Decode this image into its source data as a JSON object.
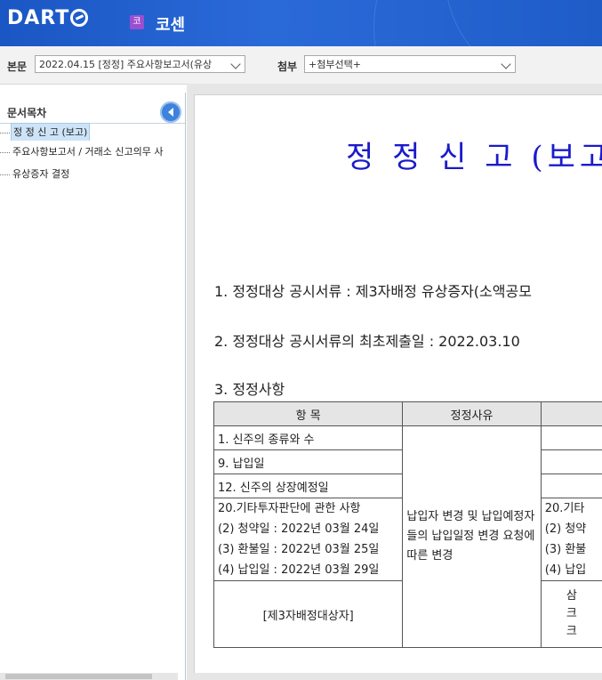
{
  "header": {
    "logo_text": "DART",
    "company_icon": "코",
    "company_name": "코센"
  },
  "toolbar": {
    "report_label": "본문",
    "report_select": "2022.04.15 [정정] 주요사항보고서(유상",
    "attach_label": "첨부",
    "attach_select": "+첨부선택+"
  },
  "sidebar": {
    "title": "문서목차",
    "items": [
      {
        "label": "정 정 신 고 (보고)",
        "selected": true
      },
      {
        "label": "주요사항보고서 / 거래소 신고의무 사"
      },
      {
        "label": "유상증자 결정"
      }
    ]
  },
  "document": {
    "title": "정 정 신 고 (보고",
    "line1": "1. 정정대상 공시서류 : 제3자배정 유상증자(소액공모",
    "line2": "2. 정정대상 공시서류의 최초제출일 : 2022.03.10",
    "line3": "3. 정정사항",
    "table": {
      "headers": [
        "항  목",
        "정정사유",
        ""
      ],
      "rows": {
        "r1": "1. 신주의 종류와 수",
        "r2": "9. 납입일",
        "r3": "12. 신주의 상장예정일",
        "r4": [
          "20.기타투자판단에 관한 사항",
          "(2) 청약일 : 2022년 03월 24일",
          "(3) 환불일 : 2022년 03월 25일",
          "(4) 납입일 : 2022년 03월 29일"
        ],
        "r5": "[제3자배정대상자]",
        "reason": "납입자 변경 및 납입예정자들의 납입일정 변경 요청에 따른 변경",
        "col3_r4": [
          "20.기타",
          "(2) 청약",
          "(3) 환불",
          "(4) 납입"
        ],
        "col3_r5": [
          "삼",
          "크",
          "크"
        ]
      }
    }
  }
}
